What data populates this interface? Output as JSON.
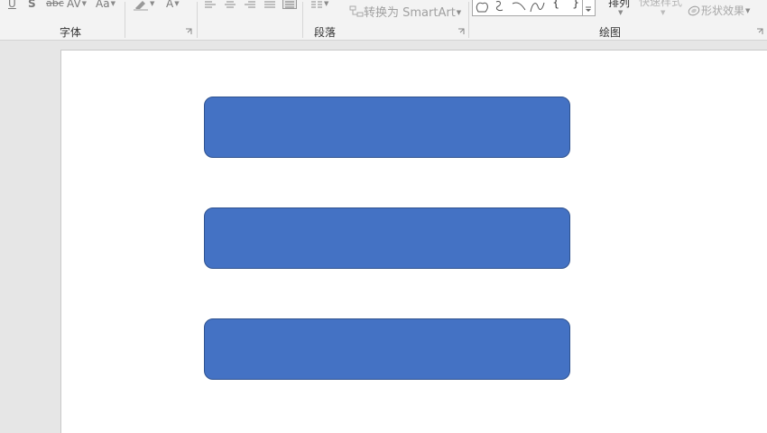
{
  "ribbon": {
    "font_group": {
      "label": "字体",
      "underline_glyph": "U",
      "shadow_glyph": "S",
      "strikethrough_glyph": "abc",
      "spacing_glyph": "AV",
      "case_glyph": "Aa",
      "font_color_glyph": "A"
    },
    "paragraph_group": {
      "label": "段落",
      "smartart_label": "转换为 SmartArt"
    },
    "drawing_group": {
      "label": "绘图",
      "arrange_label": "排列",
      "quick_styles_label": "快速样式",
      "shape_effects_label": "形状效果",
      "brace_open_glyph": "{",
      "brace_close_glyph": "}"
    }
  },
  "slide": {
    "shape_color": "#4472c4",
    "shape_border_color": "#2f528f"
  }
}
